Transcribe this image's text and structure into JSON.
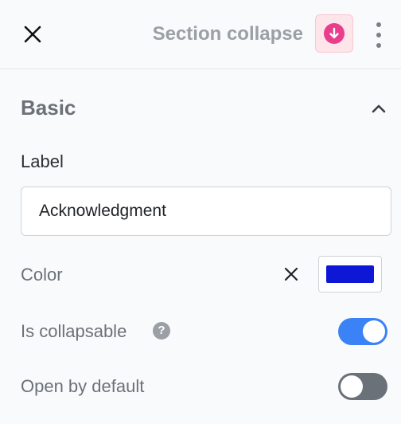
{
  "header": {
    "title": "Section collapse",
    "close_icon": "close-icon",
    "action_icon": "arrow-down-circle-icon",
    "menu_icon": "kebab-menu-icon"
  },
  "section": {
    "title": "Basic",
    "toggle_icon": "chevron-up-icon"
  },
  "fields": {
    "label": {
      "label": "Label",
      "value": "Acknowledgment",
      "placeholder": ""
    },
    "color": {
      "label": "Color",
      "value": "#0f17d6",
      "clear_icon": "close-icon"
    },
    "is_collapsable": {
      "label": "Is collapsable",
      "help_icon": "help-circle-icon",
      "help_glyph": "?",
      "enabled": true
    },
    "open_by_default": {
      "label": "Open by default",
      "enabled": false
    }
  },
  "colors": {
    "toggle_on": "#3b82f6",
    "toggle_off": "#6b7178",
    "accent": "#e83e8c"
  }
}
